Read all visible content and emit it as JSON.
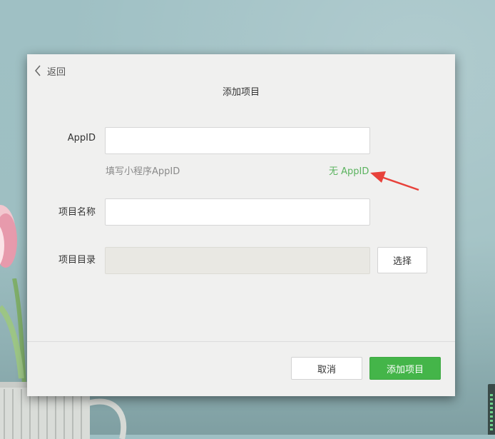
{
  "dialog": {
    "back_label": "返回",
    "title": "添加项目"
  },
  "form": {
    "appid": {
      "label": "AppID",
      "value": "",
      "hint": "填写小程序AppID",
      "no_appid_link": "无 AppID"
    },
    "project_name": {
      "label": "项目名称",
      "value": ""
    },
    "project_dir": {
      "label": "项目目录",
      "value": "",
      "choose_label": "选择"
    }
  },
  "footer": {
    "cancel_label": "取消",
    "submit_label": "添加项目"
  },
  "colors": {
    "accent_green": "#44b549",
    "link_green": "#5bb35f",
    "annotation_red": "#e8413a"
  },
  "icons": {
    "back": "chevron-left-icon",
    "annotation": "red-arrow-icon"
  }
}
